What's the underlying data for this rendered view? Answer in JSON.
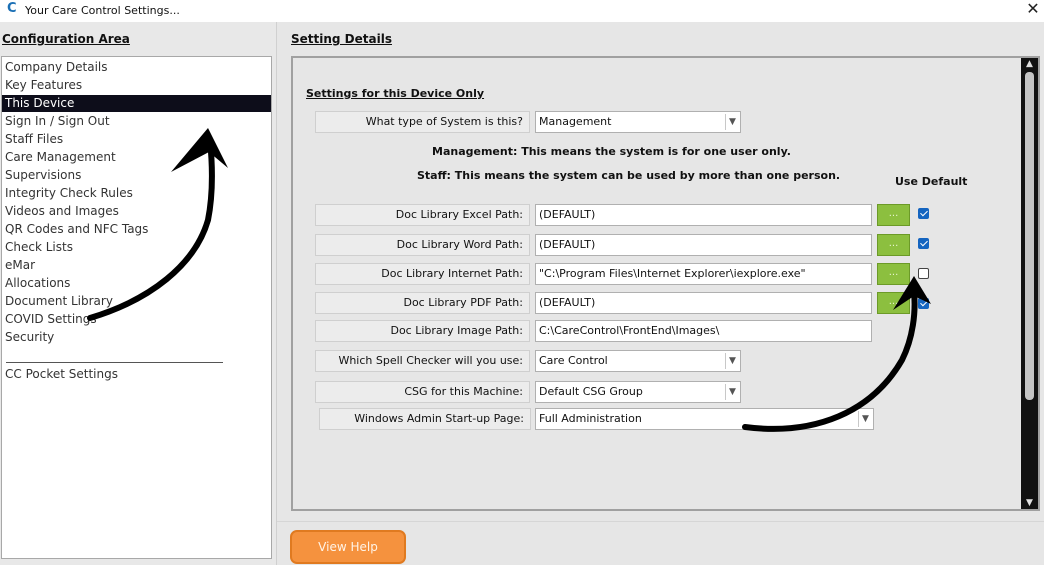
{
  "window": {
    "title": "Your Care Control Settings...",
    "close_glyph": "✕",
    "app_icon": "C"
  },
  "config_area": {
    "title": "Configuration Area",
    "items": [
      {
        "label": "Company Details"
      },
      {
        "label": "Key Features"
      },
      {
        "label": "This Device",
        "selected": true
      },
      {
        "label": "Sign In / Sign Out"
      },
      {
        "label": "Staff Files"
      },
      {
        "label": "Care Management"
      },
      {
        "label": "Supervisions"
      },
      {
        "label": "Integrity Check Rules"
      },
      {
        "label": "Videos and Images"
      },
      {
        "label": "QR Codes and NFC Tags"
      },
      {
        "label": "Check Lists"
      },
      {
        "label": "eMar"
      },
      {
        "label": "Allocations"
      },
      {
        "label": "Document Library"
      },
      {
        "label": "COVID Settings"
      },
      {
        "label": "Security"
      }
    ],
    "extra_item": "CC Pocket Settings"
  },
  "setting_details": {
    "title": "Setting Details",
    "section_title": "Settings for this Device Only",
    "system_type": {
      "label": "What type of System is this?",
      "value": "Management"
    },
    "info_management": "Management: This means the system is for one user only.",
    "info_staff": "Staff: This means the system can be used by more than one person.",
    "use_default_label": "Use Default",
    "browse_label": "...",
    "paths": [
      {
        "label": "Doc Library Excel Path:",
        "value": "(DEFAULT)",
        "use_default": true
      },
      {
        "label": "Doc Library Word Path:",
        "value": "(DEFAULT)",
        "use_default": true
      },
      {
        "label": "Doc Library Internet Path:",
        "value": "\"C:\\Program Files\\Internet Explorer\\iexplore.exe\"",
        "use_default": false
      },
      {
        "label": "Doc Library PDF Path:",
        "value": "(DEFAULT)",
        "use_default": true
      }
    ],
    "image_path": {
      "label": "Doc Library Image Path:",
      "value": "C:\\CareControl\\FrontEnd\\Images\\"
    },
    "spell_checker": {
      "label": "Which Spell Checker will you use:",
      "value": "Care Control"
    },
    "csg": {
      "label": "CSG for this Machine:",
      "value": "Default CSG Group"
    },
    "startup_page": {
      "label": "Windows Admin Start-up Page:",
      "value": "Full Administration"
    }
  },
  "footer": {
    "view_help_label": "View Help"
  },
  "colors": {
    "accent_orange": "#f5923e",
    "browse_green": "#8cbf3f",
    "checkbox_blue": "#1565c0",
    "selected_row": "#0d0d1a"
  }
}
